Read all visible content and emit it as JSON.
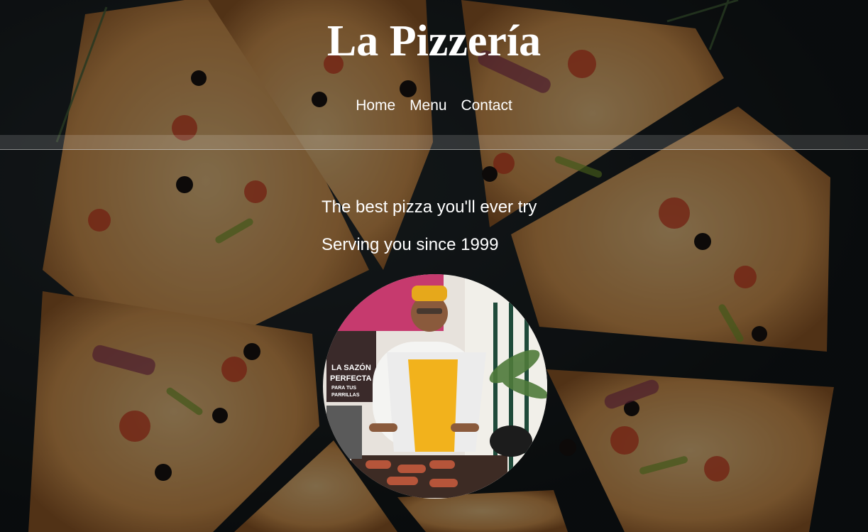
{
  "header": {
    "title": "La Pizzería"
  },
  "nav": {
    "items": [
      {
        "label": "Home"
      },
      {
        "label": "Menu"
      },
      {
        "label": "Contact"
      }
    ]
  },
  "hero": {
    "line1": "The best pizza you'll ever try",
    "line2": "Serving you since 1999"
  },
  "photo": {
    "subject": "chef-grilling-photo",
    "sign_text": "LA SAZÓN PERFECTA PARA TUS PARRILLAS"
  },
  "colors": {
    "background": "#151b1d",
    "text": "#ffffff",
    "apron": "#f2b21c"
  }
}
